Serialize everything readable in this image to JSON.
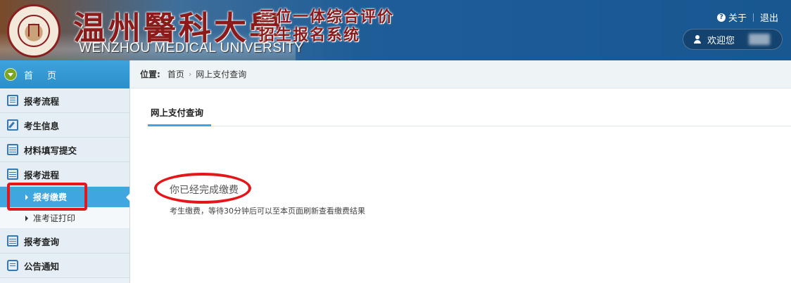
{
  "header": {
    "logo_text_cn": "温州醫科大學",
    "logo_text_en": "WENZHOU MEDICAL UNIVERSITY",
    "system_title_line1": "三位一体综合评价",
    "system_title_line2": "招生报名系统",
    "about_label": "关于",
    "logout_label": "退出",
    "welcome_label": "欢迎您"
  },
  "sidebar": {
    "home_label": "首页",
    "items": [
      {
        "label": "报考流程",
        "icon": "list-icon"
      },
      {
        "label": "考生信息",
        "icon": "edit-icon"
      },
      {
        "label": "材料填写提交",
        "icon": "calendar-icon"
      },
      {
        "label": "报考进程",
        "icon": "calendar-icon"
      },
      {
        "label": "报考查询",
        "icon": "calendar-icon"
      },
      {
        "label": "公告通知",
        "icon": "message-icon"
      }
    ],
    "subitems": [
      {
        "label": "报考缴费",
        "active": true
      },
      {
        "label": "准考证打印",
        "active": false
      }
    ]
  },
  "breadcrumb": {
    "prefix": "位置:",
    "items": [
      "首页",
      "网上支付查询"
    ]
  },
  "main": {
    "tab_label": "网上支付查询",
    "status_text": "你已经完成缴费",
    "note_text": "考生缴费，等待30分钟后可以至本页面刷新查看缴费结果"
  },
  "colors": {
    "accent": "#3fa6df",
    "annotation_red": "#e5161a",
    "header_blue": "#1f5d97"
  }
}
